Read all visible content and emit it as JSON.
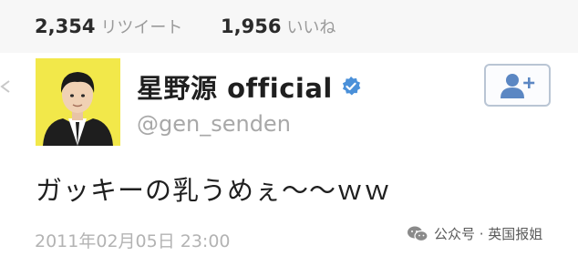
{
  "stats": {
    "retweets": {
      "count": "2,354",
      "label": "リツイート"
    },
    "likes": {
      "count": "1,956",
      "label": "いいね"
    }
  },
  "tweet": {
    "display_name": "星野源 official",
    "handle": "@gen_senden",
    "text": "ガッキーの乳うめぇ〜〜ｗｗ",
    "timestamp": "2011年02月05日 23:00",
    "verified": true
  },
  "follow_button": {
    "icon": "add-user-icon"
  },
  "watermark": {
    "text": "公众号 · 英国报姐",
    "icon": "wechat-icon"
  },
  "colors": {
    "verified_blue": "#4a90d9",
    "follow_icon_blue": "#5b87c3",
    "avatar_bg": "#f2e84a"
  }
}
